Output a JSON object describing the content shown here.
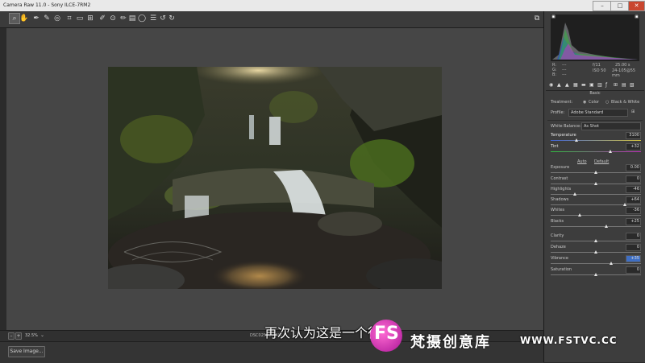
{
  "window": {
    "title": "Camera Raw 11.0  -  Sony ILCE-7RM2"
  },
  "toolbar": {
    "tools": [
      "zoom-tool",
      "hand-tool",
      "white-balance-tool",
      "color-sampler-tool",
      "targeted-adjustment-tool",
      "crop-tool",
      "straighten-tool",
      "transform-tool",
      "spot-removal-tool",
      "red-eye-tool",
      "adjustment-brush-tool",
      "graduated-filter-tool",
      "radial-filter-tool",
      "open-preferences",
      "rotate-ccw",
      "rotate-cw"
    ]
  },
  "image": {
    "filename": "DSC02540.ARW"
  },
  "status": {
    "zoom": "32.5%"
  },
  "bottom": {
    "save_label": "Save Image..."
  },
  "histogram": {
    "rgb": {
      "r_label": "R:",
      "g_label": "G:",
      "b_label": "B:",
      "r": "---",
      "g": "---",
      "b": "---"
    },
    "exif": {
      "aperture": "f/11",
      "shutter": "25.00 s",
      "iso": "ISO 50",
      "lens": "24-105@55 mm"
    }
  },
  "basic": {
    "panel_title": "Basic",
    "treatment_label": "Treatment:",
    "treatment_color": "Color",
    "treatment_bw": "Black & White",
    "profile_label": "Profile:",
    "profile_value": "Adobe Standard",
    "wb_label": "White Balance:",
    "wb_value": "As Shot",
    "auto_label": "Auto",
    "default_label": "Default",
    "sliders": [
      {
        "label": "Temperature",
        "value": "3100",
        "pos": 0.29
      },
      {
        "label": "Tint",
        "value": "+32",
        "pos": 0.66
      },
      {
        "label": "Exposure",
        "value": "0.00",
        "pos": 0.5
      },
      {
        "label": "Contrast",
        "value": "0",
        "pos": 0.5
      },
      {
        "label": "Highlights",
        "value": "-46",
        "pos": 0.27
      },
      {
        "label": "Shadows",
        "value": "+64",
        "pos": 0.82
      },
      {
        "label": "Whites",
        "value": "-36",
        "pos": 0.32
      },
      {
        "label": "Blacks",
        "value": "+25",
        "pos": 0.62
      },
      {
        "label": "Clarity",
        "value": "0",
        "pos": 0.5
      },
      {
        "label": "Dehaze",
        "value": "0",
        "pos": 0.5
      },
      {
        "label": "Vibrance",
        "value": "+35",
        "pos": 0.67
      },
      {
        "label": "Saturation",
        "value": "0",
        "pos": 0.5
      }
    ]
  },
  "subtitle": {
    "text": "再次认为这是一个很"
  },
  "watermark": {
    "letters": "FS",
    "cn": "梵摄创意库",
    "url": "WWW.FSTVC.CC"
  }
}
